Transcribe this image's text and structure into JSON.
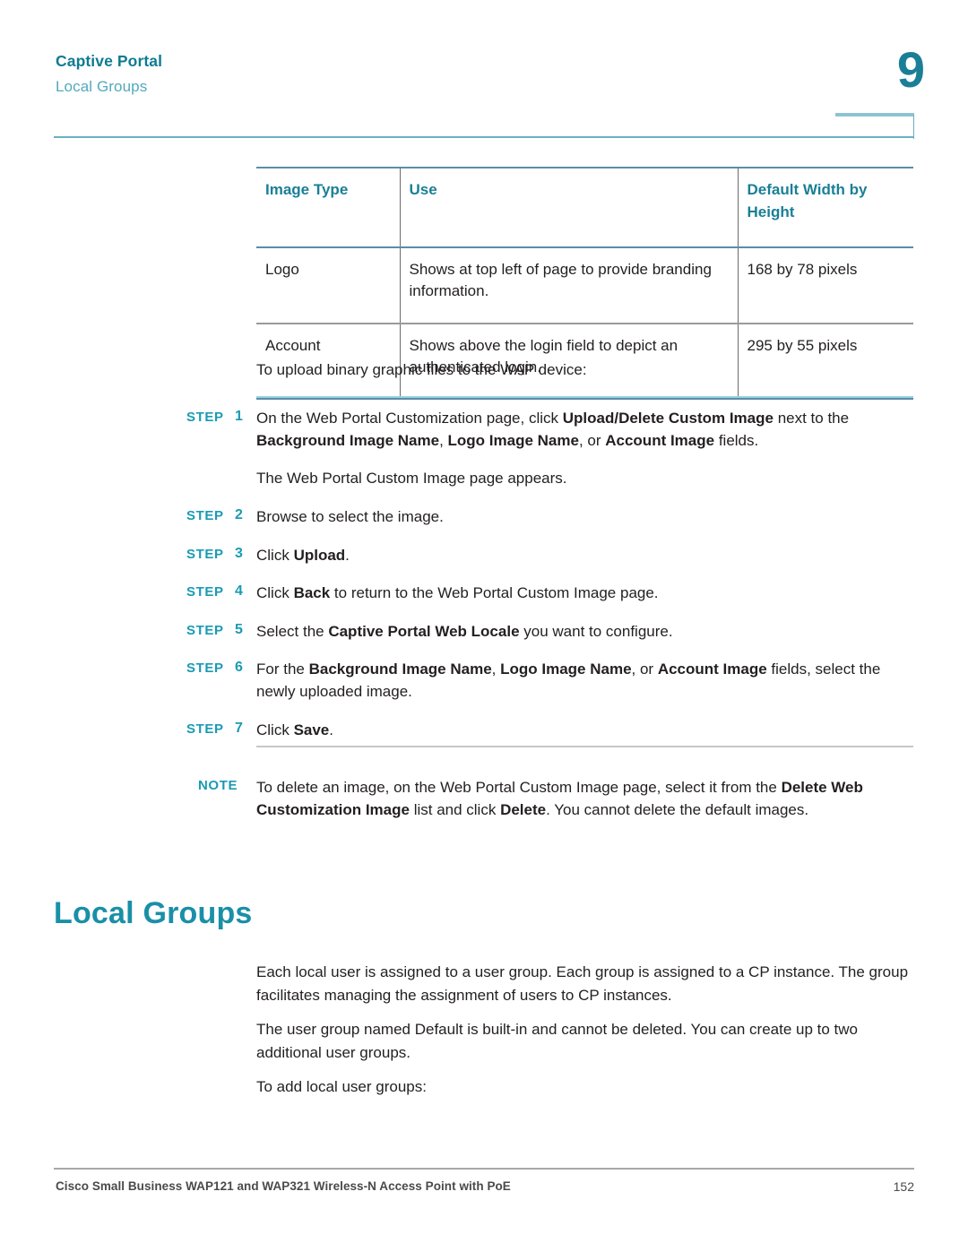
{
  "header": {
    "chapter_title": "Captive Portal",
    "section_title": "Local Groups",
    "chapter_number": "9"
  },
  "table": {
    "columns": [
      "Image Type",
      "Use",
      "Default Width by Height"
    ],
    "rows": [
      {
        "image_type": "Logo",
        "use": "Shows at top left of page to provide branding information.",
        "default_size": "168 by 78 pixels"
      },
      {
        "image_type": "Account",
        "use": "Shows above the login field to depict an authenticated login.",
        "default_size": "295 by 55 pixels"
      }
    ]
  },
  "intro": {
    "text": "To upload binary graphic files to the WAP device:"
  },
  "steps": {
    "label": "STEP",
    "items": [
      {
        "number": "1",
        "segments": [
          {
            "text": "On the Web Portal Customization page, click ",
            "bold": false
          },
          {
            "text": "Upload/Delete Custom Image",
            "bold": true
          },
          {
            "text": " next to the ",
            "bold": false
          },
          {
            "text": "Background Image Name",
            "bold": true
          },
          {
            "text": ", ",
            "bold": false
          },
          {
            "text": "Logo Image Name",
            "bold": true
          },
          {
            "text": ", or ",
            "bold": false
          },
          {
            "text": "Account Image",
            "bold": true
          },
          {
            "text": " fields.",
            "bold": false
          }
        ],
        "sub_text": "The Web Portal Custom Image page appears."
      },
      {
        "number": "2",
        "segments": [
          {
            "text": "Browse to select the image.",
            "bold": false
          }
        ],
        "sub_text": ""
      },
      {
        "number": "3",
        "segments": [
          {
            "text": "Click ",
            "bold": false
          },
          {
            "text": "Upload",
            "bold": true
          },
          {
            "text": ".",
            "bold": false
          }
        ],
        "sub_text": ""
      },
      {
        "number": "4",
        "segments": [
          {
            "text": "Click ",
            "bold": false
          },
          {
            "text": "Back",
            "bold": true
          },
          {
            "text": " to return to the Web Portal Custom Image page.",
            "bold": false
          }
        ],
        "sub_text": ""
      },
      {
        "number": "5",
        "segments": [
          {
            "text": "Select the ",
            "bold": false
          },
          {
            "text": "Captive Portal Web Locale",
            "bold": true
          },
          {
            "text": " you want to configure.",
            "bold": false
          }
        ],
        "sub_text": ""
      },
      {
        "number": "6",
        "segments": [
          {
            "text": "For the ",
            "bold": false
          },
          {
            "text": "Background Image Name",
            "bold": true
          },
          {
            "text": ", ",
            "bold": false
          },
          {
            "text": "Logo Image Name",
            "bold": true
          },
          {
            "text": ", or ",
            "bold": false
          },
          {
            "text": "Account Image",
            "bold": true
          },
          {
            "text": " fields, select the newly uploaded image.",
            "bold": false
          }
        ],
        "sub_text": ""
      },
      {
        "number": "7",
        "segments": [
          {
            "text": "Click ",
            "bold": false
          },
          {
            "text": "Save",
            "bold": true
          },
          {
            "text": ".",
            "bold": false
          }
        ],
        "sub_text": ""
      }
    ]
  },
  "note": {
    "label": "NOTE",
    "segments": [
      {
        "text": "To delete an image, on the Web Portal Custom Image page, select it from the ",
        "bold": false
      },
      {
        "text": "Delete Web Customization Image",
        "bold": true
      },
      {
        "text": " list and click ",
        "bold": false
      },
      {
        "text": "Delete",
        "bold": true
      },
      {
        "text": ". You cannot delete the default images.",
        "bold": false
      }
    ]
  },
  "section": {
    "heading": "Local Groups",
    "paragraphs": [
      "Each local user is assigned to a user group. Each group is assigned to a CP instance. The group facilitates managing the assignment of users to CP instances.",
      "The user group named Default is built-in and cannot be deleted. You can create up to two additional user groups.",
      "To add local user groups:"
    ]
  },
  "footer": {
    "left": "Cisco Small Business WAP121 and WAP321 Wireless-N Access Point with PoE",
    "page_number": "152"
  },
  "colors": {
    "heading_teal": "#1a8fa8",
    "accent_teal": "#1a9bb4",
    "rule_teal": "#6ab0c0",
    "table_border": "#5b8ca8"
  }
}
